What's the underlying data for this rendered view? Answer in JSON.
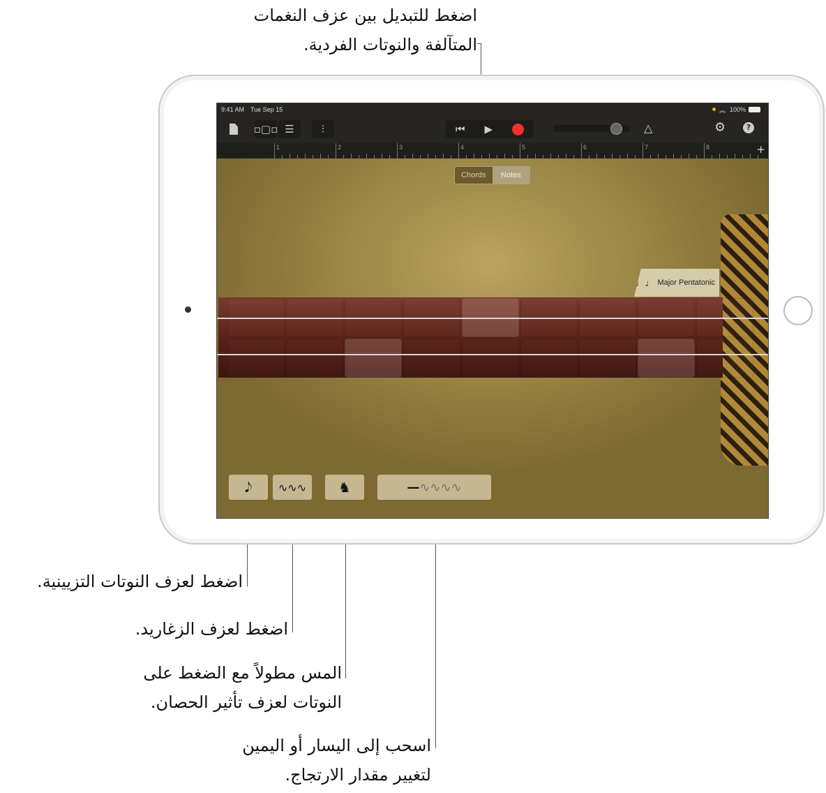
{
  "callouts": {
    "top": [
      "اضغط للتبديل بين عزف النغمات",
      "المتآلفة والنوتات الفردية."
    ],
    "ornament": "اضغط لعزف النوتات التزيينية.",
    "trill": "اضغط لعزف الزغاريد.",
    "horse": [
      "المس مطولاً مع الضغط على",
      "النوتات لعزف تأثير الحصان."
    ],
    "glide": [
      "اسحب إلى اليسار أو اليمين",
      "لتغيير مقدار الارتجاج."
    ]
  },
  "status": {
    "time": "9:41 AM",
    "date": "Tue Sep 15",
    "battery": "100%"
  },
  "ruler": {
    "bars": [
      "1",
      "2",
      "3",
      "4",
      "5",
      "6",
      "7",
      "8"
    ],
    "add": "+"
  },
  "toggle": {
    "chords": "Chords",
    "notes": "Notes",
    "selected": "Notes"
  },
  "scale": {
    "icon": "♩♩",
    "label": "Major Pentatonic"
  },
  "toolbar": {
    "help": "?"
  },
  "colors": {
    "record": "#f0302a",
    "accent_dot": "#f5a623"
  }
}
